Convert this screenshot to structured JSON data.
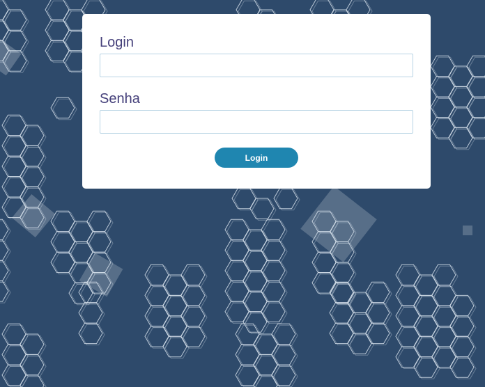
{
  "theme": {
    "background": "#2e4a6b",
    "card_background": "#ffffff",
    "label_color": "#443f7a",
    "button_color": "#1f86b0",
    "input_border": "#b8d4e4"
  },
  "background_decoration": "hexagon-pattern",
  "login_form": {
    "username_label": "Login",
    "username_value": "",
    "password_label": "Senha",
    "password_value": "",
    "submit_label": "Login"
  }
}
